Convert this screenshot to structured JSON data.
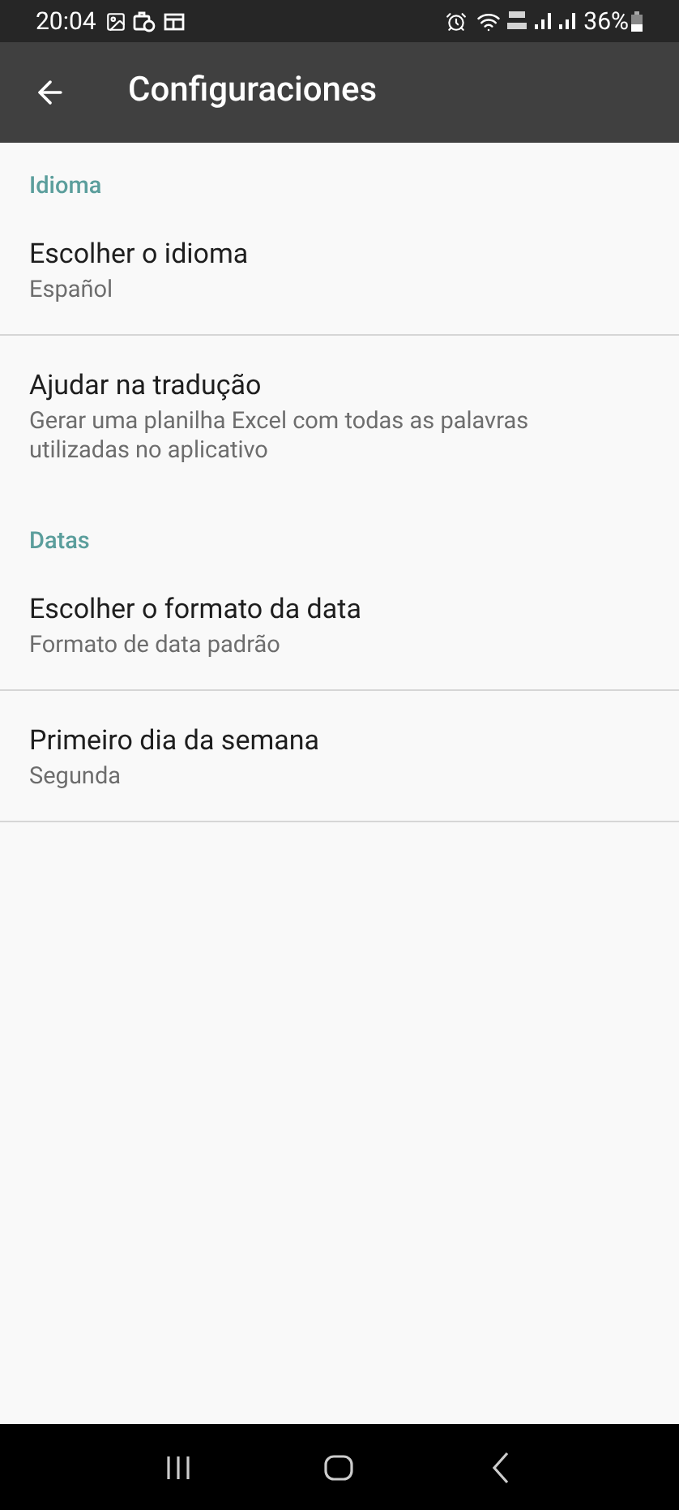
{
  "status_bar": {
    "time": "20:04",
    "battery": "36%"
  },
  "app_bar": {
    "title": "Configuraciones"
  },
  "sections": [
    {
      "title": "Idioma",
      "items": [
        {
          "title": "Escolher o idioma",
          "subtitle": "Español",
          "divider": true
        },
        {
          "title": "Ajudar na tradução",
          "subtitle": "Gerar uma planilha Excel com todas as palavras utilizadas no aplicativo",
          "divider": false
        }
      ]
    },
    {
      "title": "Datas",
      "items": [
        {
          "title": "Escolher o formato da data",
          "subtitle": "Formato de data padrão",
          "divider": true
        },
        {
          "title": "Primeiro dia da semana",
          "subtitle": "Segunda",
          "divider": true
        }
      ]
    }
  ]
}
